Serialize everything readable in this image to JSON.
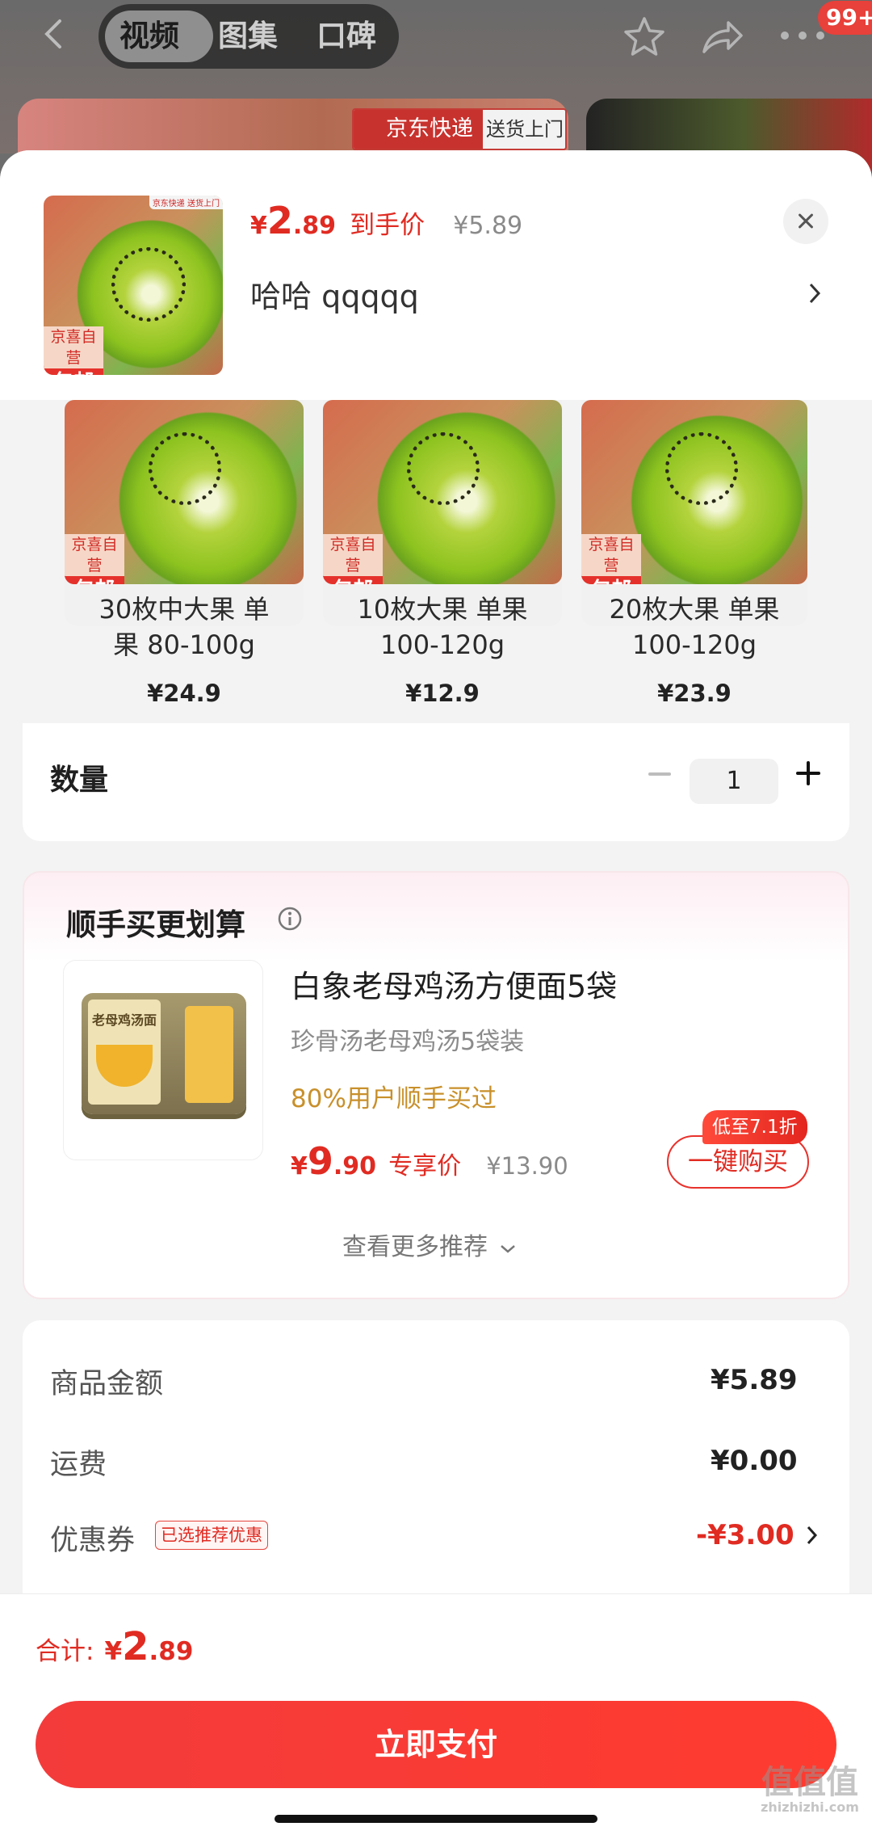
{
  "background": {
    "tabs": [
      "视频",
      "图集",
      "口碑"
    ],
    "badge": "99+",
    "delivery_tag": {
      "brand": "京东快递",
      "service": "送货上门"
    }
  },
  "product": {
    "price": {
      "symbol": "¥",
      "int": "2",
      "dec": ".89",
      "label": "到手价",
      "original": "¥5.89"
    },
    "variant_text": "哈哈   qqqqq",
    "thumb_tag": {
      "line1": "京喜自营",
      "line2": "包邮",
      "corner": "京东快递 送货上门"
    }
  },
  "skus": [
    {
      "name_line1": "30枚中大果 单",
      "name_line2": "果 80-100g",
      "price": "¥24.9",
      "tag1": "京喜自营",
      "tag2": "包邮"
    },
    {
      "name_line1": "10枚大果 单果",
      "name_line2": "100-120g",
      "price": "¥12.9",
      "tag1": "京喜自营",
      "tag2": "包邮"
    },
    {
      "name_line1": "20枚大果 单果",
      "name_line2": "100-120g",
      "price": "¥23.9",
      "tag1": "京喜自营",
      "tag2": "包邮"
    }
  ],
  "quantity": {
    "label": "数量",
    "value": "1"
  },
  "recommend": {
    "title": "顺手买更划算",
    "product_title": "白象老母鸡汤方便面5袋",
    "product_subtitle": "珍骨汤老母鸡汤5袋装",
    "social_proof": "80%用户顺手买过",
    "price": {
      "symbol": "¥",
      "int": "9",
      "dec": ".90",
      "label": "专享价",
      "original": "¥13.90"
    },
    "discount_tag": "低至7.1折",
    "buy_label": "一键购买",
    "more_label": "查看更多推荐",
    "package_text": "老母鸡汤面"
  },
  "fees": {
    "goods_label": "商品金额",
    "goods_value": "¥5.89",
    "shipping_label": "运费",
    "shipping_value": "¥0.00",
    "coupon_label": "优惠券",
    "coupon_tag": "已选推荐优惠",
    "coupon_value": "-¥3.00"
  },
  "total": {
    "label": "合计:",
    "symbol": "¥",
    "int": "2",
    "dec": ".89"
  },
  "pay_label": "立即支付",
  "watermark": {
    "glyphs": "值值值",
    "domain": "zhizhizhi.com"
  },
  "colors": {
    "accent": "#e02b22",
    "pay_button": "#f33b3b",
    "discount_orange": "#c8902b"
  }
}
